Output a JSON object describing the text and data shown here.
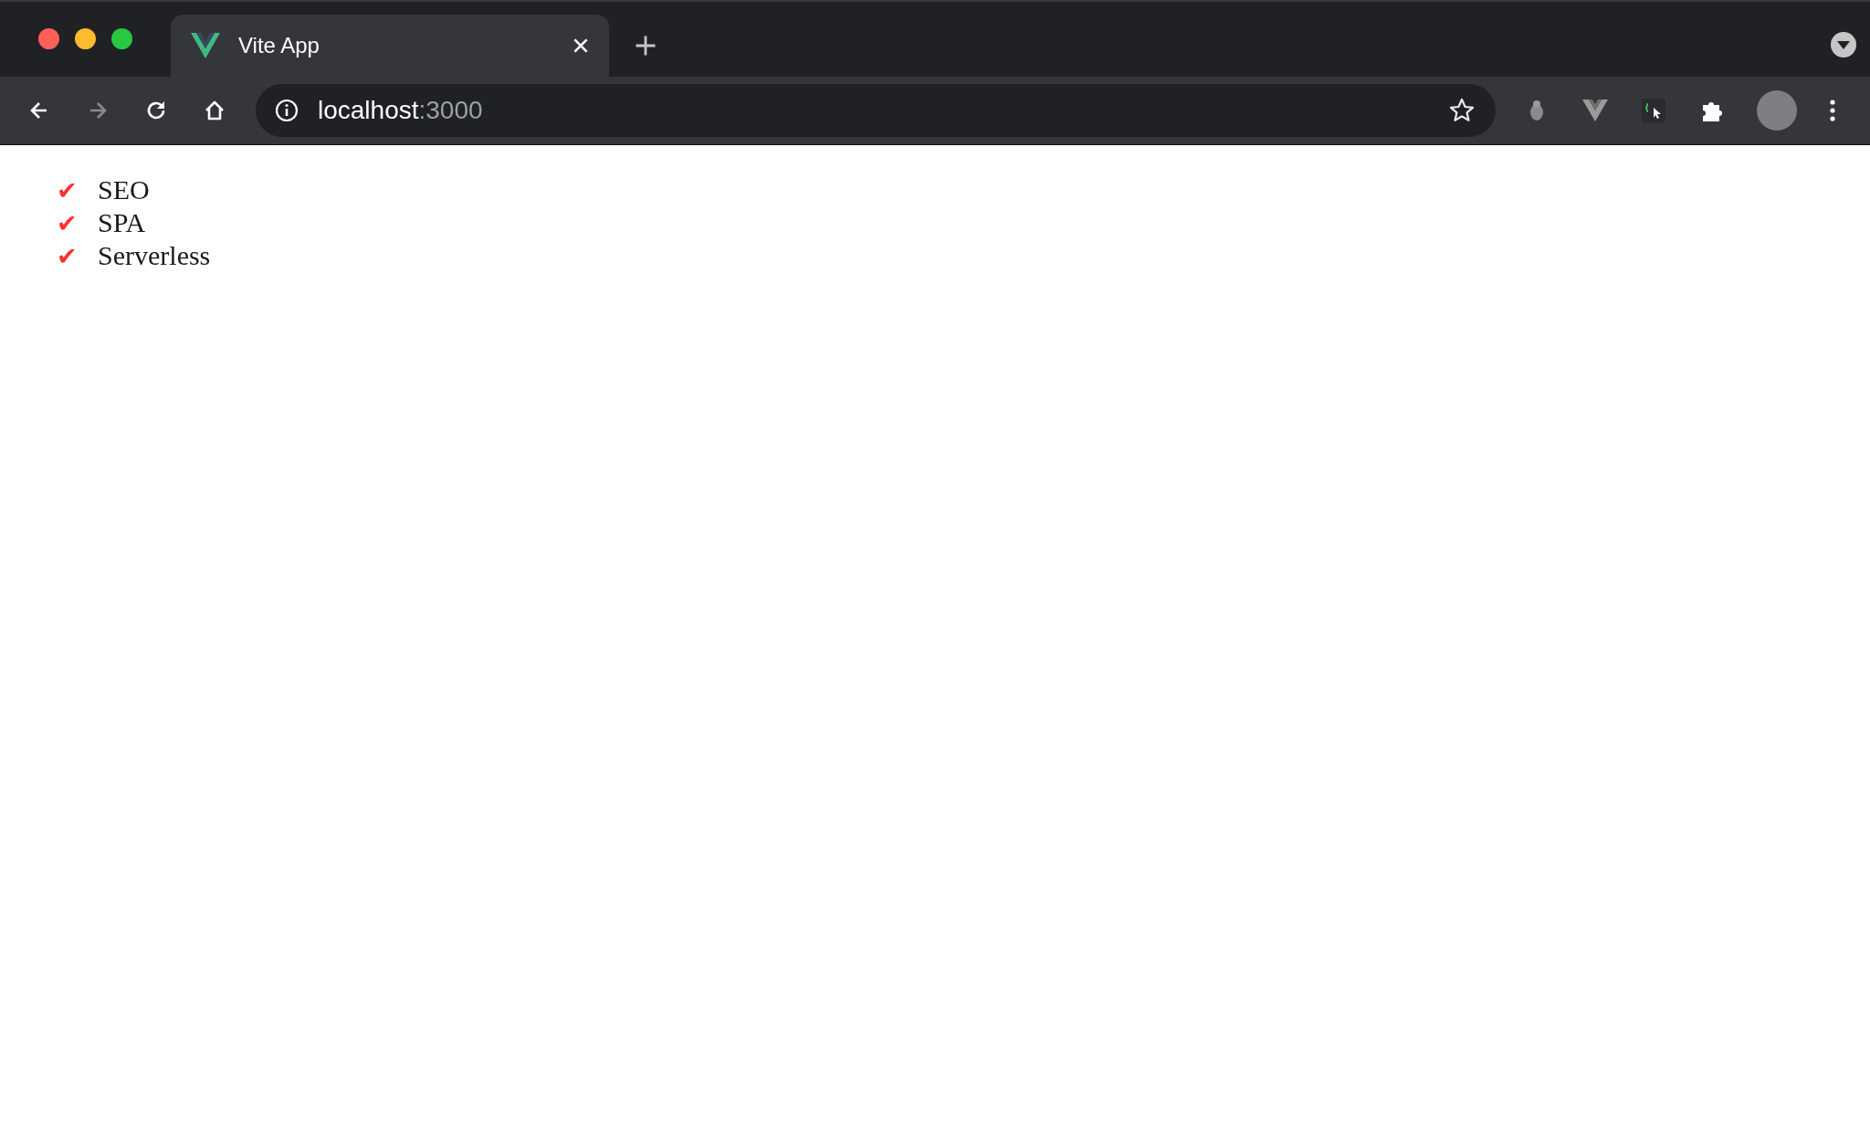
{
  "window": {
    "tab": {
      "title": "Vite App",
      "selected": true
    }
  },
  "toolbar": {
    "buttons": [
      {
        "kind": "back",
        "disabled": false
      },
      {
        "kind": "forward",
        "disabled": true
      },
      {
        "kind": "reload",
        "disabled": false
      },
      {
        "kind": "home",
        "disabled": false
      }
    ],
    "address": {
      "host": "localhost",
      "port": ":3000"
    }
  },
  "list": [
    {
      "mark": "✔",
      "label": "SEO"
    },
    {
      "mark": "✔",
      "label": "SPA"
    },
    {
      "mark": "✔",
      "label": "Serverless"
    }
  ]
}
